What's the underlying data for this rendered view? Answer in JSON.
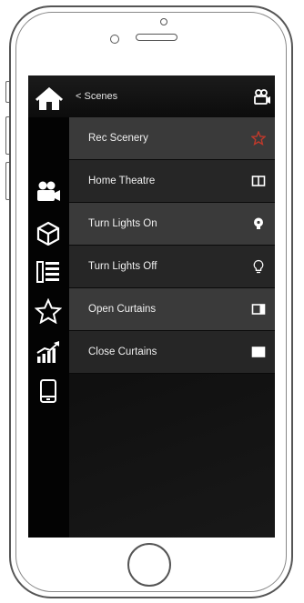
{
  "header": {
    "back_label": "< Scenes"
  },
  "sidebar": {
    "icons": [
      "home-icon",
      "scene-camera-icon",
      "cube-icon",
      "devices-list-icon",
      "star-icon",
      "stats-chart-icon",
      "tablet-icon"
    ]
  },
  "scenes": [
    {
      "label": "Rec Scenery",
      "icon": "star-outline-icon"
    },
    {
      "label": "Home Theatre",
      "icon": "book-icon"
    },
    {
      "label": "Turn Lights On",
      "icon": "lightbulb-on-icon"
    },
    {
      "label": "Turn Lights Off",
      "icon": "lightbulb-off-icon"
    },
    {
      "label": "Open Curtains",
      "icon": "curtain-open-icon"
    },
    {
      "label": "Close Curtains",
      "icon": "curtain-closed-icon"
    }
  ],
  "colors": {
    "screen_bg": "#0b0b0b",
    "row_dark": "#262626",
    "row_light": "#3a3a3a",
    "text": "#f0f0f0",
    "star_accent": "#c0392b"
  }
}
